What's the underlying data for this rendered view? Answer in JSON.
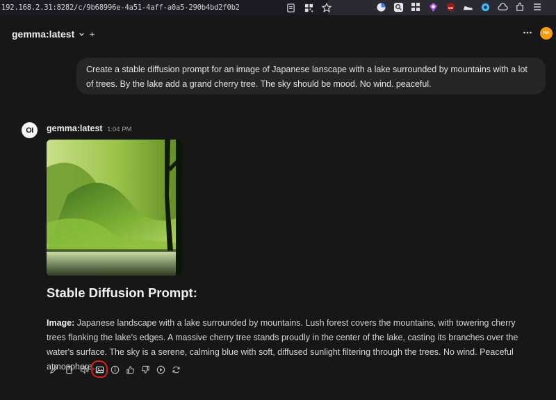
{
  "browser": {
    "url": "192.168.2.31:8282/c/9b68996e-4a51-4aff-a0a5-290b4bd2f0b2"
  },
  "header": {
    "model_name": "gemma:latest",
    "avatar_initials": "HA",
    "avatar_color": "#f59e0b"
  },
  "user_message": {
    "text": "Create a stable diffusion prompt for an image of Japanese lanscape with a lake surrounded by mountains with a lot of trees. By the lake add a grand cherry tree. The sky should be mood. No wind. peaceful."
  },
  "assistant": {
    "avatar_text": "OI",
    "name": "gemma:latest",
    "time": "1:04 PM",
    "heading": "Stable Diffusion Prompt:",
    "image_label": "Image:",
    "body": "Japanese landscape with a lake surrounded by mountains. Lush forest covers the mountains, with towering cherry trees flanking the lake's edges. A massive cherry tree stands proudly in the center of the lake, casting its branches over the water's surface. The sky is a serene, calming blue with soft, diffused sunlight filtering through the trees. No wind. Peaceful atmosphere."
  },
  "actions": [
    {
      "name": "edit-icon"
    },
    {
      "name": "copy-icon"
    },
    {
      "name": "read-aloud-icon"
    },
    {
      "name": "generate-image-icon"
    },
    {
      "name": "info-icon"
    },
    {
      "name": "thumbs-up-icon"
    },
    {
      "name": "thumbs-down-icon"
    },
    {
      "name": "continue-icon"
    },
    {
      "name": "regenerate-icon"
    }
  ],
  "colors": {
    "background": "#171717",
    "bubble": "#262626",
    "highlight": "#e11d1d"
  }
}
